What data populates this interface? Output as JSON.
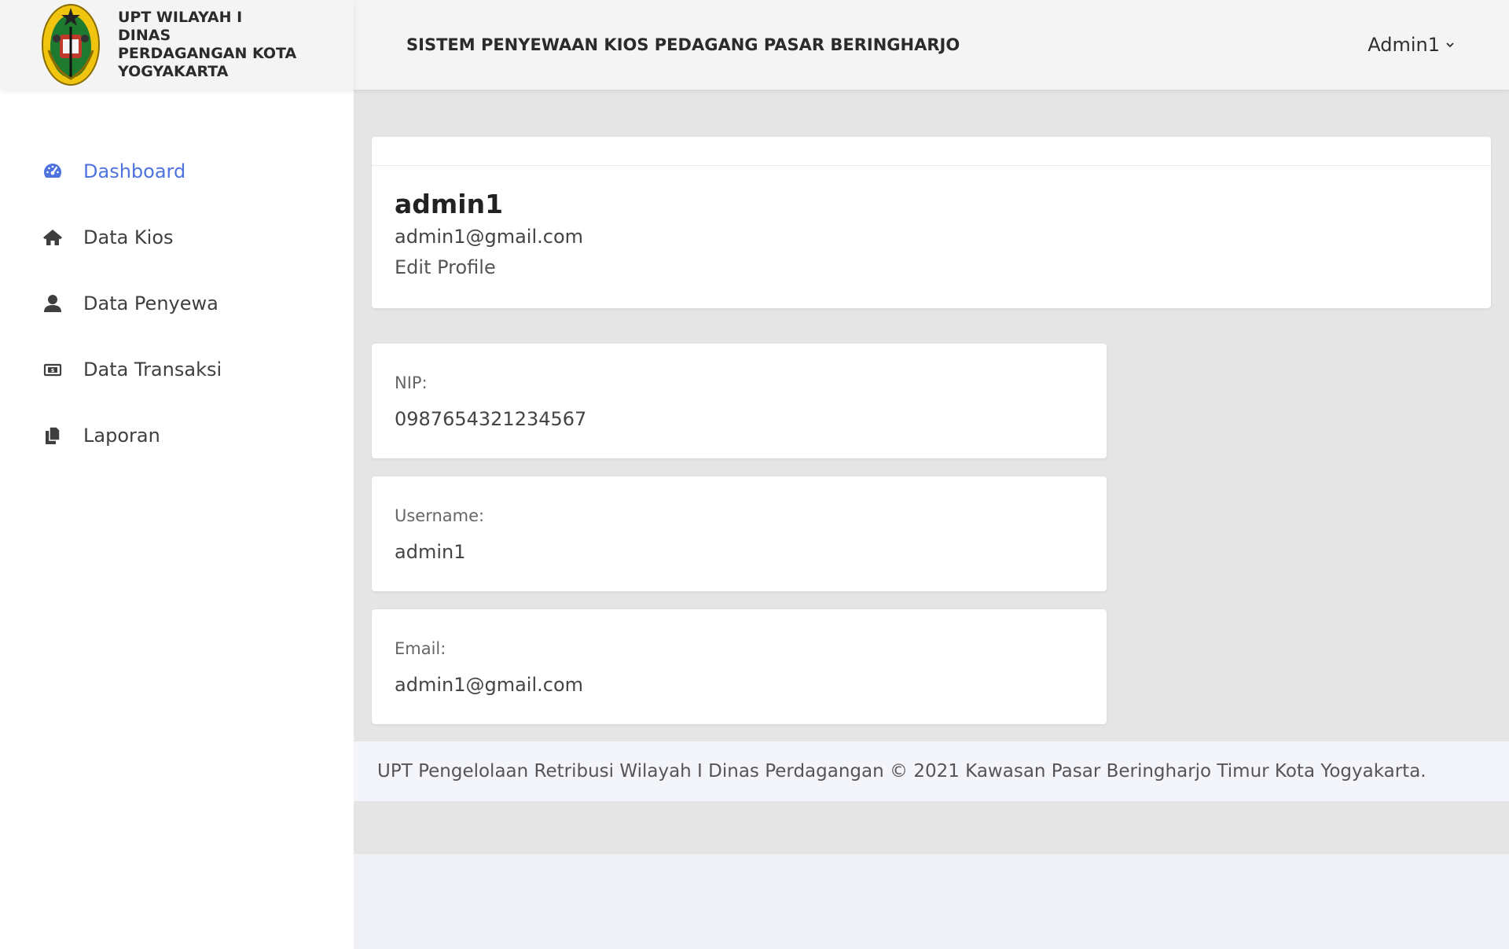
{
  "brand": {
    "title": "UPT WILAYAH I DINAS PERDAGANGAN KOTA YOGYAKARTA",
    "logo_icon": "yogyakarta-coat-of-arms-icon"
  },
  "header": {
    "title": "SISTEM PENYEWAAN KIOS PEDAGANG PASAR BERINGHARJO",
    "user_name": "Admin1",
    "user_menu_icon": "chevron-down-icon"
  },
  "sidebar": {
    "items": [
      {
        "label": "Dashboard",
        "icon": "tachometer-icon",
        "active": true
      },
      {
        "label": "Data Kios",
        "icon": "home-icon",
        "active": false
      },
      {
        "label": "Data Penyewa",
        "icon": "user-icon",
        "active": false
      },
      {
        "label": "Data Transaksi",
        "icon": "money-bill-icon",
        "active": false
      },
      {
        "label": "Laporan",
        "icon": "copy-icon",
        "active": false
      }
    ]
  },
  "profile": {
    "name": "admin1",
    "email": "admin1@gmail.com",
    "edit_label": "Edit Profile"
  },
  "details": [
    {
      "label": "NIP:",
      "value": "0987654321234567"
    },
    {
      "label": "Username:",
      "value": "admin1"
    },
    {
      "label": "Email:",
      "value": "admin1@gmail.com"
    }
  ],
  "footer": {
    "text": "UPT Pengelolaan Retribusi Wilayah I Dinas Perdagangan © 2021 Kawasan Pasar Beringharjo Timur Kota Yogyakarta."
  },
  "colors": {
    "accent": "#4e73df",
    "content_bg": "#e5e5e5",
    "bar_bg": "#f4f4f4"
  }
}
